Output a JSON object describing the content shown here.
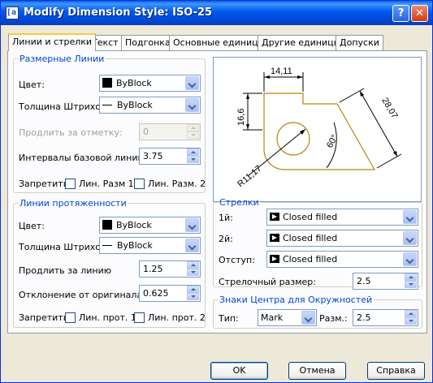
{
  "window": {
    "title": "Modify Dimension Style: ISO-25",
    "help_label": "?",
    "close_label": "✕",
    "app_icon_label": "[a]"
  },
  "tabs": [
    "Линии и стрелки",
    "Текст",
    "Подгонка",
    "Основные единицы",
    "Другие единицы",
    "Допуски"
  ],
  "active_tab": "Линии и стрелки",
  "dim_lines": {
    "legend": "Размерные Линии",
    "color_label": "Цвет:",
    "color_value": "ByBlock",
    "lineweight_label": "Толщина Штрихов",
    "lineweight_value": "ByBlock",
    "extend_label": "Продлить за отметку:",
    "extend_value": "0",
    "baseline_label": "Интервалы базовой линии:",
    "baseline_value": "3.75",
    "suppress_label": "Запретить:",
    "suppress_1": "Лин. Разм 1",
    "suppress_2": "Лин. Разм. 2"
  },
  "ext_lines": {
    "legend": "Линии протяженности",
    "color_label": "Цвет:",
    "color_value": "ByBlock",
    "lineweight_label": "Толщина Штрихов",
    "lineweight_value": "ByBlock",
    "extend_label": "Продлить за линию",
    "extend_value": "1.25",
    "offset_label": "Отклонение от оригинала:",
    "offset_value": "0.625",
    "suppress_label": "Запретить:",
    "suppress_1": "Лин. прот. 1",
    "suppress_2": "Лин. прот. 2"
  },
  "preview": {
    "dim_top": "14,11",
    "dim_left": "16,6",
    "dim_diag": "28,07",
    "dim_angle": "60°",
    "dim_radius": "R11,17"
  },
  "arrows": {
    "legend": "Стрелки",
    "first_label": "1й:",
    "first_value": "Closed filled",
    "second_label": "2й:",
    "second_value": "Closed filled",
    "leader_label": "Отступ:",
    "leader_value": "Closed filled",
    "size_label": "Стрелочный размер:",
    "size_value": "2.5"
  },
  "center_marks": {
    "legend": "Знаки Центра для Окружностей",
    "type_label": "Тип:",
    "type_value": "Mark",
    "size_label": "Разм.:",
    "size_value": "2.5"
  },
  "buttons": {
    "ok": "OK",
    "cancel": "Отмена",
    "help": "Справка"
  },
  "colors": {
    "title_bar": "#0054e3",
    "group_legend": "#0046d5",
    "preview_outline": "#b8860b",
    "dialog_bg": "#ece9d8"
  }
}
